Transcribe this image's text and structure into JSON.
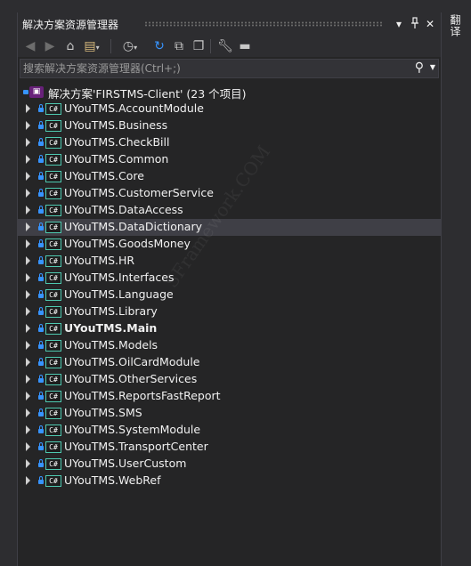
{
  "panel": {
    "title": "解决方案资源管理器",
    "pin_glyph": "▾",
    "autohide_glyph": "⊥",
    "close_glyph": "✕"
  },
  "toolbar": {
    "icons": [
      "back-icon",
      "forward-icon",
      "home-icon",
      "sync-icon",
      "history-icon",
      "refresh-icon",
      "collapse-all-icon",
      "show-all-files-icon",
      "properties-icon",
      "preview-icon"
    ]
  },
  "search": {
    "placeholder": "搜索解决方案资源管理器(Ctrl+;)"
  },
  "solution": {
    "label": "解决方案'FIRSTMS-Client' (23 个项目)"
  },
  "projects": [
    {
      "name": "UYouTMS.AccountModule",
      "bold": false,
      "selected": false
    },
    {
      "name": "UYouTMS.Business",
      "bold": false,
      "selected": false
    },
    {
      "name": "UYouTMS.CheckBill",
      "bold": false,
      "selected": false
    },
    {
      "name": "UYouTMS.Common",
      "bold": false,
      "selected": false
    },
    {
      "name": "UYouTMS.Core",
      "bold": false,
      "selected": false
    },
    {
      "name": "UYouTMS.CustomerService",
      "bold": false,
      "selected": false
    },
    {
      "name": "UYouTMS.DataAccess",
      "bold": false,
      "selected": false
    },
    {
      "name": "UYouTMS.DataDictionary",
      "bold": false,
      "selected": true
    },
    {
      "name": "UYouTMS.GoodsMoney",
      "bold": false,
      "selected": false
    },
    {
      "name": "UYouTMS.HR",
      "bold": false,
      "selected": false
    },
    {
      "name": "UYouTMS.Interfaces",
      "bold": false,
      "selected": false
    },
    {
      "name": "UYouTMS.Language",
      "bold": false,
      "selected": false
    },
    {
      "name": "UYouTMS.Library",
      "bold": false,
      "selected": false
    },
    {
      "name": "UYouTMS.Main",
      "bold": true,
      "selected": false
    },
    {
      "name": "UYouTMS.Models",
      "bold": false,
      "selected": false
    },
    {
      "name": "UYouTMS.OilCardModule",
      "bold": false,
      "selected": false
    },
    {
      "name": "UYouTMS.OtherServices",
      "bold": false,
      "selected": false
    },
    {
      "name": "UYouTMS.ReportsFastReport",
      "bold": false,
      "selected": false
    },
    {
      "name": "UYouTMS.SMS",
      "bold": false,
      "selected": false
    },
    {
      "name": "UYouTMS.SystemModule",
      "bold": false,
      "selected": false
    },
    {
      "name": "UYouTMS.TransportCenter",
      "bold": false,
      "selected": false
    },
    {
      "name": "UYouTMS.UserCustom",
      "bold": false,
      "selected": false
    },
    {
      "name": "UYouTMS.WebRef",
      "bold": false,
      "selected": false
    }
  ],
  "project_badge": "C#",
  "watermark": "SFramework.COM",
  "side_tab": "翻译"
}
